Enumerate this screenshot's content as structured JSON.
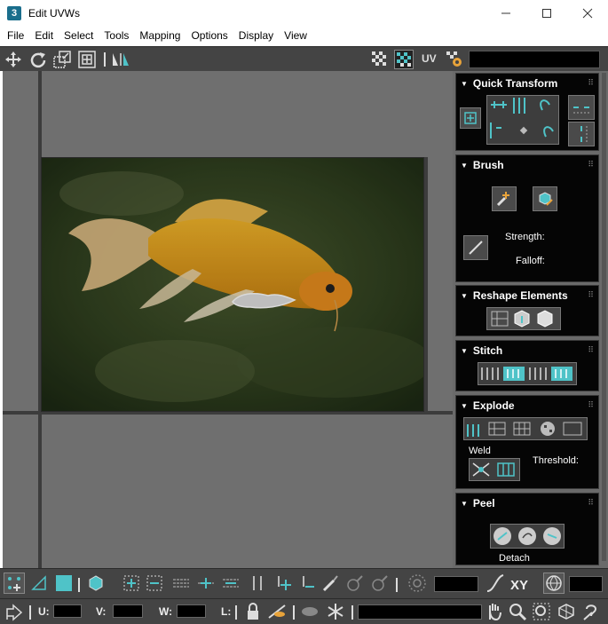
{
  "window": {
    "app_icon_text": "3",
    "title": "Edit UVWs",
    "minimize": "—",
    "maximize": "☐",
    "close": "✕"
  },
  "menu": [
    "File",
    "Edit",
    "Select",
    "Tools",
    "Mapping",
    "Options",
    "Display",
    "View"
  ],
  "toolbar": {
    "uv_label": "UV",
    "icons": [
      "move-icon",
      "rotate-icon",
      "scale-icon",
      "freeform-icon",
      "mirror-icon",
      "checker-icon",
      "checker-pattern-icon",
      "uv-settings-icon"
    ]
  },
  "panel": {
    "quick_transform": {
      "title": "Quick Transform"
    },
    "brush": {
      "title": "Brush",
      "strength_label": "Strength:",
      "falloff_label": "Falloff:"
    },
    "reshape": {
      "title": "Reshape Elements"
    },
    "stitch": {
      "title": "Stitch"
    },
    "explode": {
      "title": "Explode",
      "weld_label": "Weld",
      "threshold_label": "Threshold:"
    },
    "peel": {
      "title": "Peel",
      "detach_label": "Detach"
    },
    "grip": "⠿"
  },
  "bottom": {
    "xy_label": "XY",
    "u_label": "U:",
    "v_label": "V:",
    "w_label": "W:",
    "l_label": "L:"
  },
  "colors": {
    "accent": "#4fc3c8",
    "toolbar_bg": "#444444",
    "viewport_bg": "#6f6f6f",
    "panel_bg": "#050505"
  }
}
